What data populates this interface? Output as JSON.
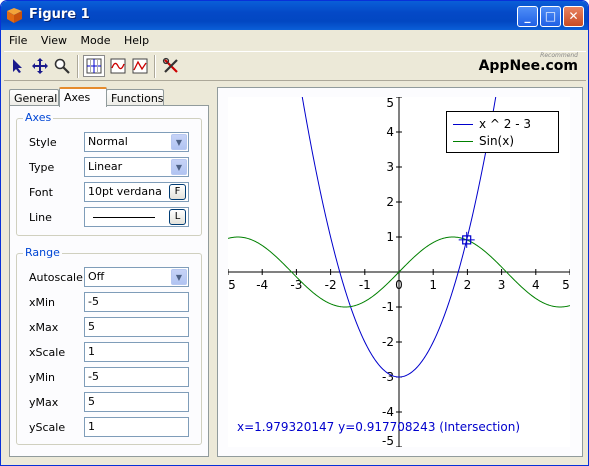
{
  "window": {
    "title": "Figure 1",
    "minimize": "_",
    "maximize": "□",
    "close": "✕"
  },
  "menu": [
    "File",
    "View",
    "Mode",
    "Help"
  ],
  "toolbar": {
    "tools": [
      "select-arrow",
      "move",
      "zoom",
      "axes-grid",
      "function-plot",
      "analysis",
      "settings-tools"
    ],
    "logo": "AppNee.com",
    "logo_small": "Recommend"
  },
  "tabs": [
    "General",
    "Axes",
    "Functions"
  ],
  "active_tab": "Axes",
  "axes_group": {
    "label": "Axes",
    "style": {
      "label": "Style",
      "value": "Normal"
    },
    "type": {
      "label": "Type",
      "value": "Linear"
    },
    "font": {
      "label": "Font",
      "value": "10pt verdana",
      "button": "F"
    },
    "line": {
      "label": "Line",
      "button": "L"
    }
  },
  "range_group": {
    "label": "Range",
    "autoscale": {
      "label": "Autoscale",
      "value": "Off"
    },
    "xmin": {
      "label": "xMin",
      "value": "-5"
    },
    "xmax": {
      "label": "xMax",
      "value": "5"
    },
    "xscale": {
      "label": "xScale",
      "value": "1"
    },
    "ymin": {
      "label": "yMin",
      "value": "-5"
    },
    "ymax": {
      "label": "yMax",
      "value": "5"
    },
    "yscale": {
      "label": "yScale",
      "value": "1"
    }
  },
  "chart_data": {
    "type": "line",
    "xlim": [
      -5,
      5
    ],
    "ylim": [
      -5,
      5
    ],
    "x_ticks": [
      "5",
      "-4",
      "-3",
      "-2",
      "-1",
      "0",
      "1",
      "2",
      "3",
      "4",
      "5"
    ],
    "y_ticks": [
      "5",
      "4",
      "3",
      "2",
      "1",
      "-1",
      "-2",
      "-3",
      "-4",
      "-5"
    ],
    "series": [
      {
        "name": "x ^ 2 - 3",
        "color": "#0000cc",
        "expr": "x*x-3"
      },
      {
        "name": "Sin(x)",
        "color": "#008000",
        "expr": "sin(x)"
      }
    ],
    "marker": {
      "x": 1.979320147,
      "y": 0.917708243
    },
    "readout": "x=1.979320147 y=0.917708243 (Intersection)"
  }
}
